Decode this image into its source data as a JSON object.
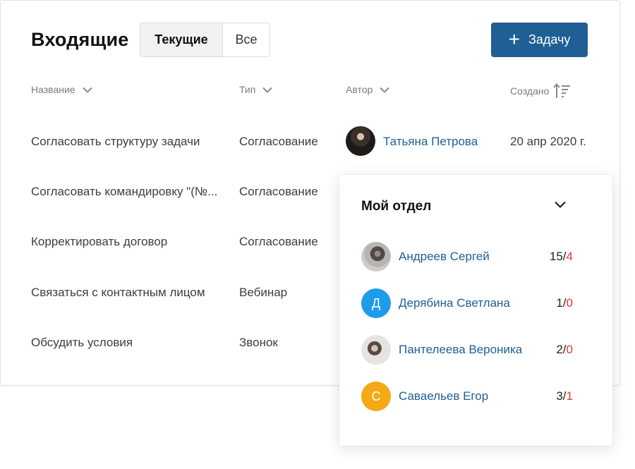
{
  "header": {
    "title": "Входящие",
    "tabs": [
      {
        "label": "Текущие",
        "active": true
      },
      {
        "label": "Все",
        "active": false
      }
    ],
    "add_button_icon": "+",
    "add_button_label": "Задачу"
  },
  "table": {
    "columns": [
      {
        "label": "Название",
        "icon": "chevron-down-icon"
      },
      {
        "label": "Тип",
        "icon": "chevron-down-icon"
      },
      {
        "label": "Автор",
        "icon": "chevron-down-icon"
      },
      {
        "label": "Создано",
        "icon": "sort-icon"
      }
    ],
    "rows": [
      {
        "name": "Согласовать структуру задачи",
        "type": "Согласование",
        "author": "Татьяна Петрова",
        "created": "20 апр 2020 г."
      },
      {
        "name": "Согласовать командировку \"(№...",
        "type": "Согласование"
      },
      {
        "name": "Корректировать договор",
        "type": "Согласование"
      },
      {
        "name": "Связаться с контактным лицом",
        "type": "Вебинар"
      },
      {
        "name": "Обсудить условия",
        "type": "Звонок"
      }
    ]
  },
  "popup": {
    "title": "Мой отдел",
    "members": [
      {
        "name": "Андреев Сергей",
        "total": "15/",
        "overdue": "4",
        "avatar": "photo"
      },
      {
        "name": "Дерябина Светлана",
        "total": "1/",
        "overdue": "0",
        "initial": "Д",
        "color": "#1e9be9"
      },
      {
        "name": "Пантелеева Вероника",
        "total": "2/",
        "overdue": "0",
        "avatar": "photo"
      },
      {
        "name": "Саваельев Егор",
        "total": "3/",
        "overdue": "1",
        "initial": "С",
        "color": "#f5a914"
      }
    ]
  },
  "colors": {
    "accent": "#1f5f95",
    "overdue": "#e53935"
  }
}
